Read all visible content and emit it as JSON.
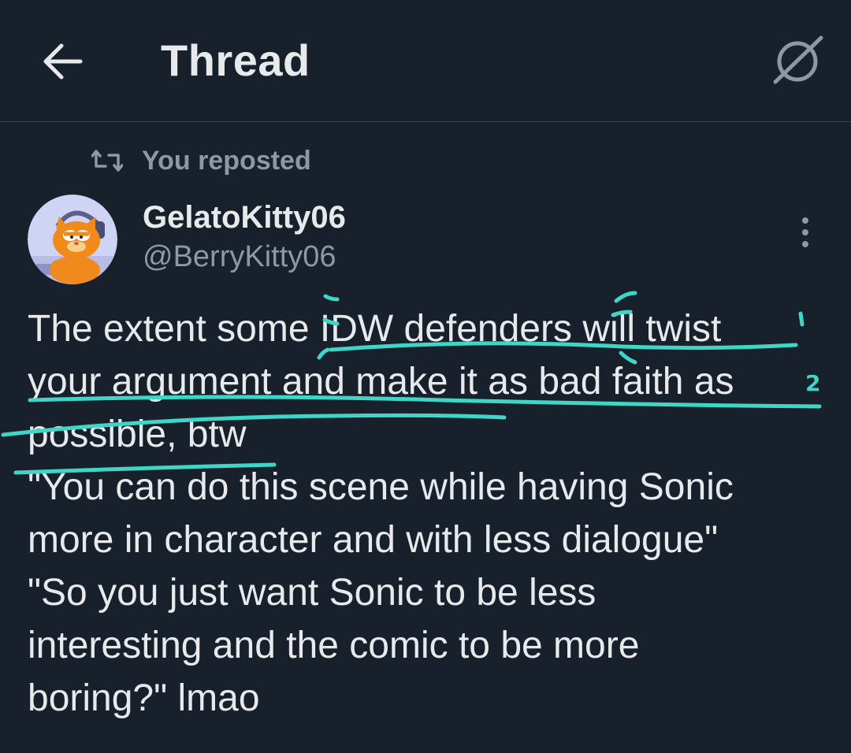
{
  "header": {
    "title": "Thread",
    "back_icon": "arrow-left-icon",
    "timeline_icon": "slashed-circle-icon"
  },
  "post": {
    "repost_label": "You reposted",
    "repost_icon": "repost-icon",
    "author": {
      "display_name": "GelatoKitty06",
      "handle": "@BerryKitty06",
      "avatar_icon": "avatar-cartoon-cat"
    },
    "more_icon": "more-vertical-icon",
    "lines": [
      "The extent some IDW defenders will twist",
      "your argument and make it as bad faith as",
      "possible, btw",
      "\"You can do this scene while having Sonic",
      "more in character and with less dialogue\"",
      "\"So you just want Sonic to be less",
      "interesting and the comic to be more",
      "boring?\" lmao"
    ]
  },
  "annotations": {
    "color": "#3fd6c8",
    "marks": [
      "1",
      "2"
    ]
  },
  "colors": {
    "background": "#17202b",
    "text_primary": "#e7e9ea",
    "text_secondary": "#8b98a5",
    "divider": "#3a4552",
    "highlight": "#3fd6c8"
  }
}
